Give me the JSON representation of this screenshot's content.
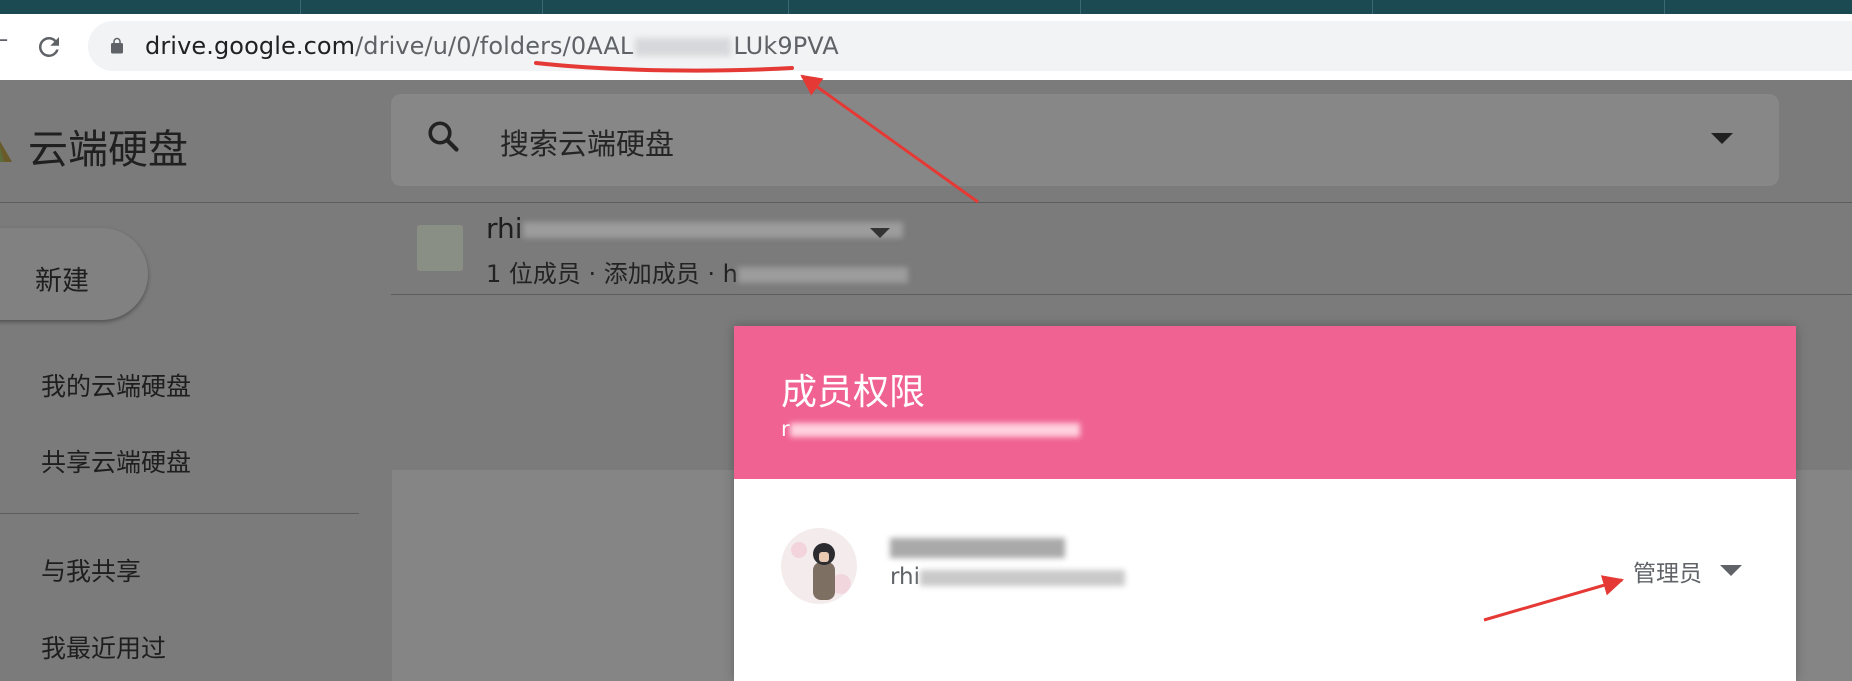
{
  "browser": {
    "url_host": "drive.google.com",
    "url_path_start": "/drive/u/0/folders/0AAL",
    "url_path_end": "LUk9PVA"
  },
  "app": {
    "brand": "云端硬盘",
    "search_placeholder": "搜索云端硬盘",
    "new_button": "新建",
    "nav": [
      "我的云端硬盘",
      "共享云端硬盘",
      "与我共享",
      "我最近用过"
    ]
  },
  "shared_drive": {
    "name_prefix": "rhi",
    "meta_prefix": "1 位成员 · 添加成员 · h"
  },
  "dialog": {
    "title": "成员权限",
    "subtitle_prefix": "r",
    "member": {
      "email_prefix": "rhi",
      "role": "管理员"
    }
  },
  "colors": {
    "accent": "#f06292",
    "annotation": "#e53935",
    "overlay": "#7b7b7b"
  }
}
